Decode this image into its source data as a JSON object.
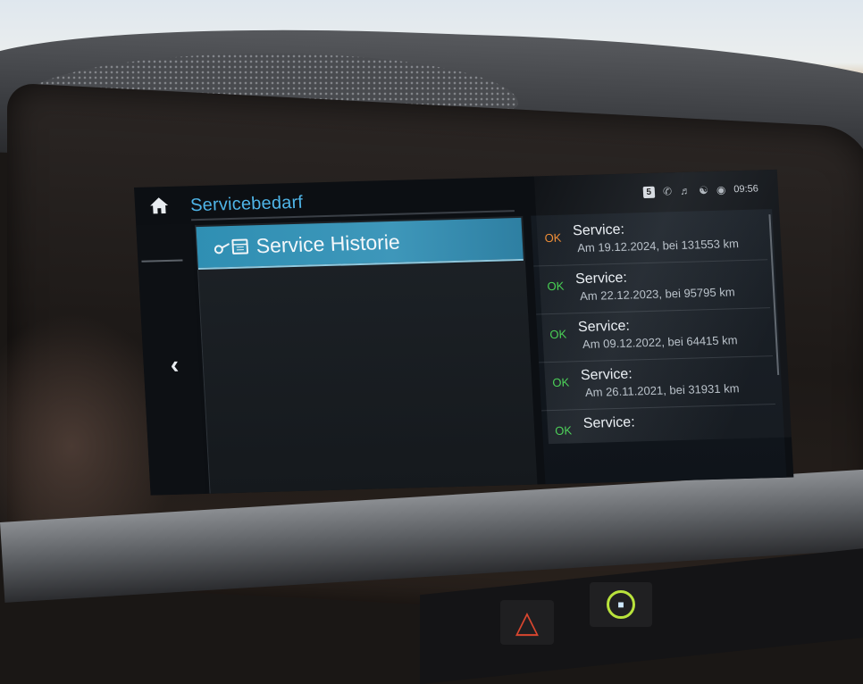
{
  "header": {
    "title": "Servicebedarf",
    "status": {
      "badge": "5",
      "time": "09:56",
      "icons": [
        "phone-icon",
        "speaker-icon",
        "user-icon",
        "gps-icon"
      ]
    }
  },
  "list": {
    "items": [
      {
        "label": "Service Historie",
        "icon": "key-calendar-icon"
      }
    ]
  },
  "history": {
    "entries": [
      {
        "status": "OK",
        "title": "Service:",
        "detail": "Am 19.12.2024, bei 131553 km",
        "status_color": "#f08a2e"
      },
      {
        "status": "OK",
        "title": "Service:",
        "detail": "Am 22.12.2023, bei 95795 km",
        "status_color": "#3fd14a"
      },
      {
        "status": "OK",
        "title": "Service:",
        "detail": "Am 09.12.2022, bei 64415 km",
        "status_color": "#3fd14a"
      },
      {
        "status": "OK",
        "title": "Service:",
        "detail": "Am 26.11.2021, bei 31931 km",
        "status_color": "#3fd14a"
      },
      {
        "status": "OK",
        "title": "Service:",
        "detail": "",
        "status_color": "#3fd14a"
      }
    ]
  },
  "colors": {
    "accent": "#4fb5e8",
    "highlight": "#3e97ba",
    "ok_orange": "#f08a2e",
    "ok_green": "#3fd14a"
  },
  "icons": {
    "home": "home-icon",
    "back": "chevron-left-icon",
    "hazard": "hazard-warning-icon",
    "lock": "car-lock-icon"
  }
}
